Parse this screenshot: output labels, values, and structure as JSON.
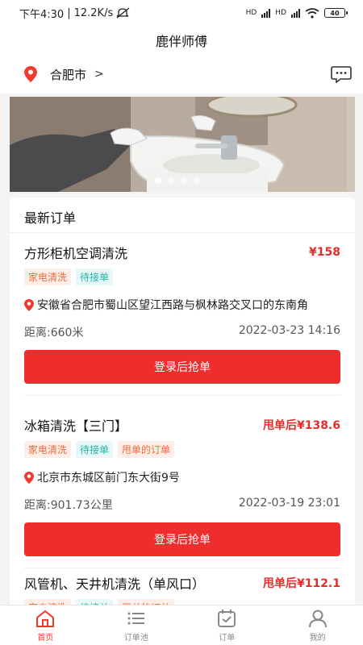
{
  "status": {
    "time": "下午4:30",
    "speed": "12.2K/s",
    "net1": "HD",
    "net2": "HD",
    "battery": "40"
  },
  "header": {
    "title": "鹿伴师傅"
  },
  "location": {
    "city": "合肥市",
    "arrow": ">"
  },
  "banner": {
    "dots": 4,
    "active_dot": 0
  },
  "orders_section": {
    "title": "最新订单"
  },
  "orders": [
    {
      "title": "方形柜机空调清洗",
      "price": "¥158",
      "tags": [
        "家电清洗",
        "待接单"
      ],
      "address": "安徽省合肥市蜀山区望江西路与枫林路交叉口的东南角",
      "distance": "距离:660米",
      "time": "2022-03-23 14:16",
      "button": "登录后抢单"
    },
    {
      "title": "冰箱清洗【三门】",
      "price": "甩单后¥138.6",
      "tags": [
        "家电清洗",
        "待接单",
        "甩单的订单"
      ],
      "address": "北京市东城区前门东大街9号",
      "distance": "距离:901.73公里",
      "time": "2022-03-19 23:01",
      "button": "登录后抢单"
    },
    {
      "title": "风管机、天井机清洗（单风口）",
      "price": "甩单后¥112.1",
      "tags": [
        "家电清洗",
        "待接单",
        "甩单的订单"
      ]
    }
  ],
  "tabbar": {
    "items": [
      {
        "label": "首页",
        "icon": "home-icon",
        "active": true
      },
      {
        "label": "订单池",
        "icon": "list-icon",
        "active": false
      },
      {
        "label": "订单",
        "icon": "calendar-check-icon",
        "active": false
      },
      {
        "label": "我的",
        "icon": "user-icon",
        "active": false
      }
    ]
  },
  "colors": {
    "accent": "#f02d2d",
    "price": "#e82b2b",
    "tag_orange_bg": "#fdeee8",
    "tag_orange_text": "#ef6a3f",
    "tag_teal_bg": "#e6f8f7",
    "tag_teal_text": "#2ab3aa"
  }
}
